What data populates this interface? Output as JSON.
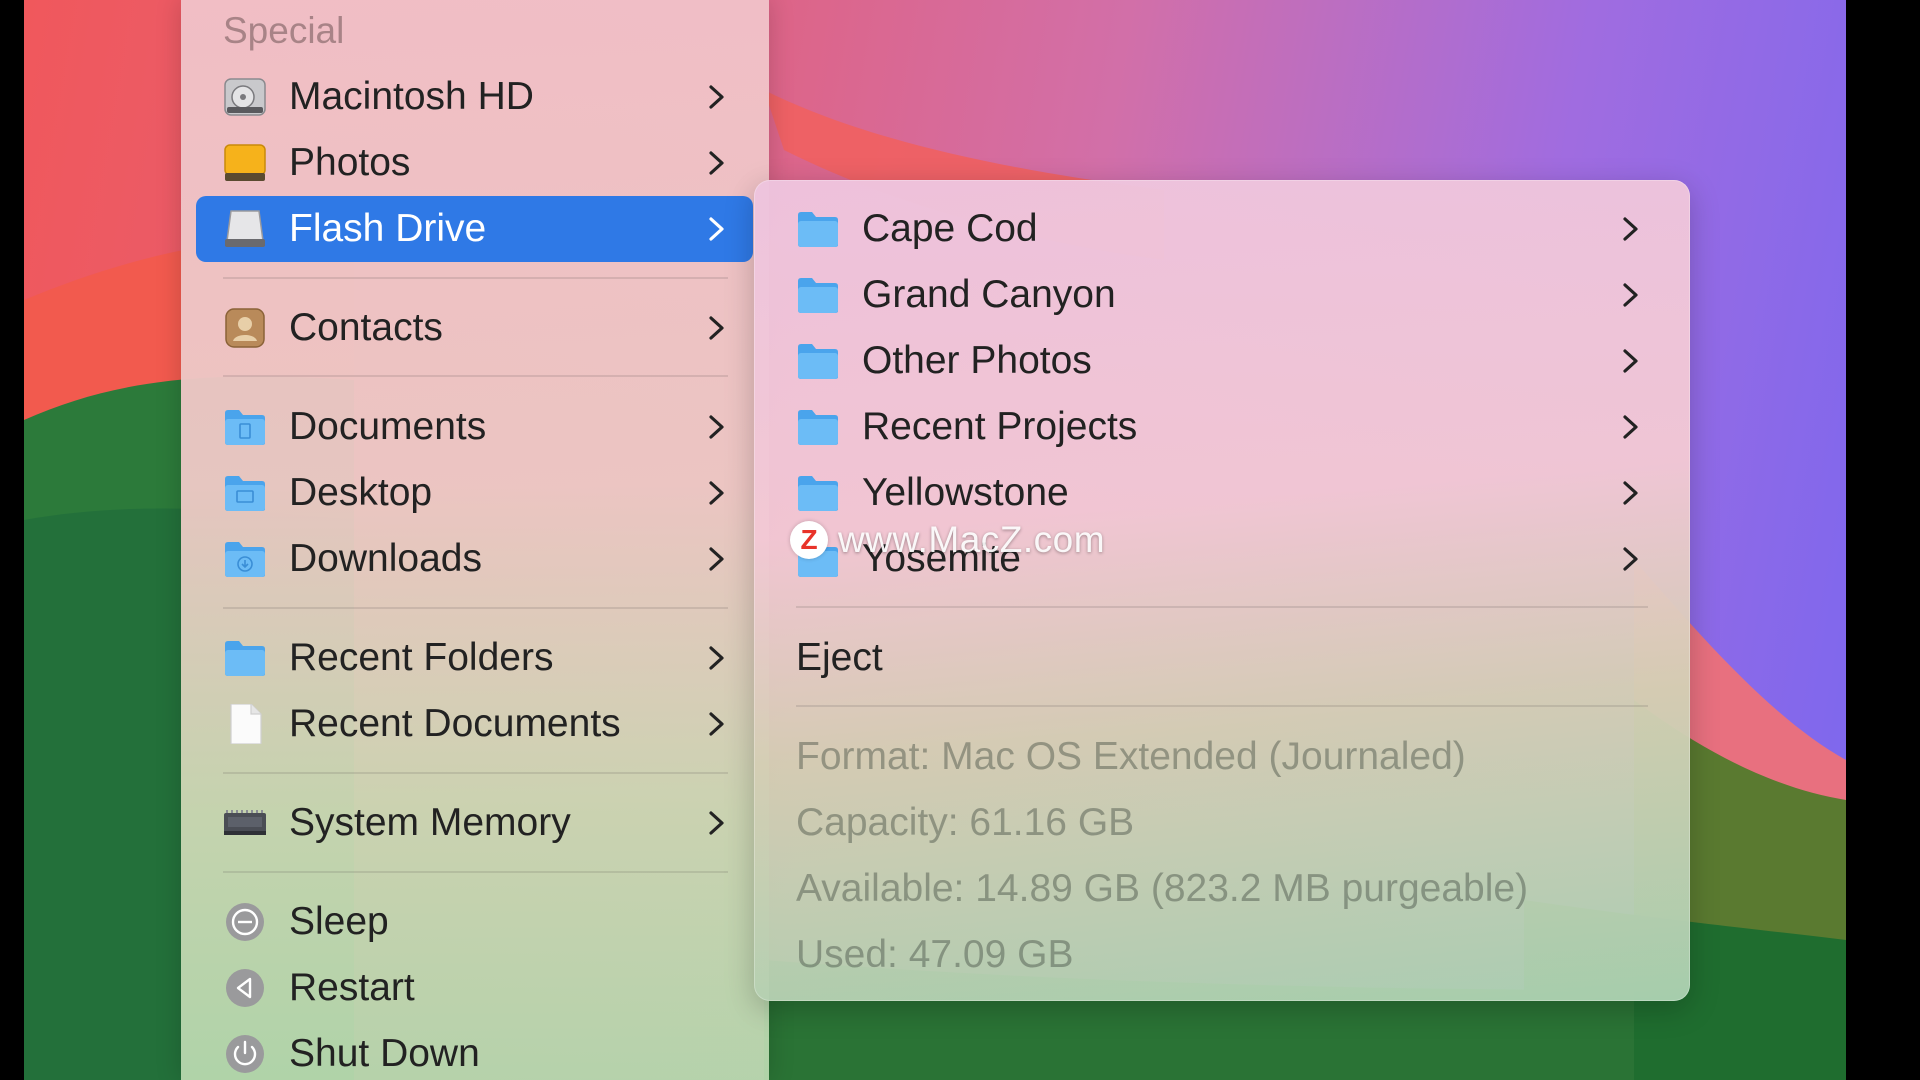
{
  "menu": {
    "section_title": "Special",
    "items": [
      {
        "label": "Macintosh HD"
      },
      {
        "label": "Photos"
      },
      {
        "label": "Flash Drive"
      },
      {
        "label": "Contacts"
      },
      {
        "label": "Documents"
      },
      {
        "label": "Desktop"
      },
      {
        "label": "Downloads"
      },
      {
        "label": "Recent Folders"
      },
      {
        "label": "Recent Documents"
      },
      {
        "label": "System Memory"
      },
      {
        "label": "Sleep"
      },
      {
        "label": "Restart"
      },
      {
        "label": "Shut Down"
      }
    ]
  },
  "submenu": {
    "folders": [
      {
        "label": "Cape Cod"
      },
      {
        "label": "Grand Canyon"
      },
      {
        "label": "Other Photos"
      },
      {
        "label": "Recent Projects"
      },
      {
        "label": "Yellowstone"
      },
      {
        "label": "Yosemite"
      }
    ],
    "eject_label": "Eject",
    "info": {
      "format": "Format: Mac OS Extended (Journaled)",
      "capacity": "Capacity: 61.16 GB",
      "available": "Available: 14.89 GB (823.2 MB purgeable)",
      "used": "Used: 47.09 GB"
    }
  },
  "watermark": {
    "logo_letter": "Z",
    "text": "www.MacZ.com"
  },
  "colors": {
    "selection": "#2f79e6",
    "folder_blue": "#5fb3f2"
  }
}
